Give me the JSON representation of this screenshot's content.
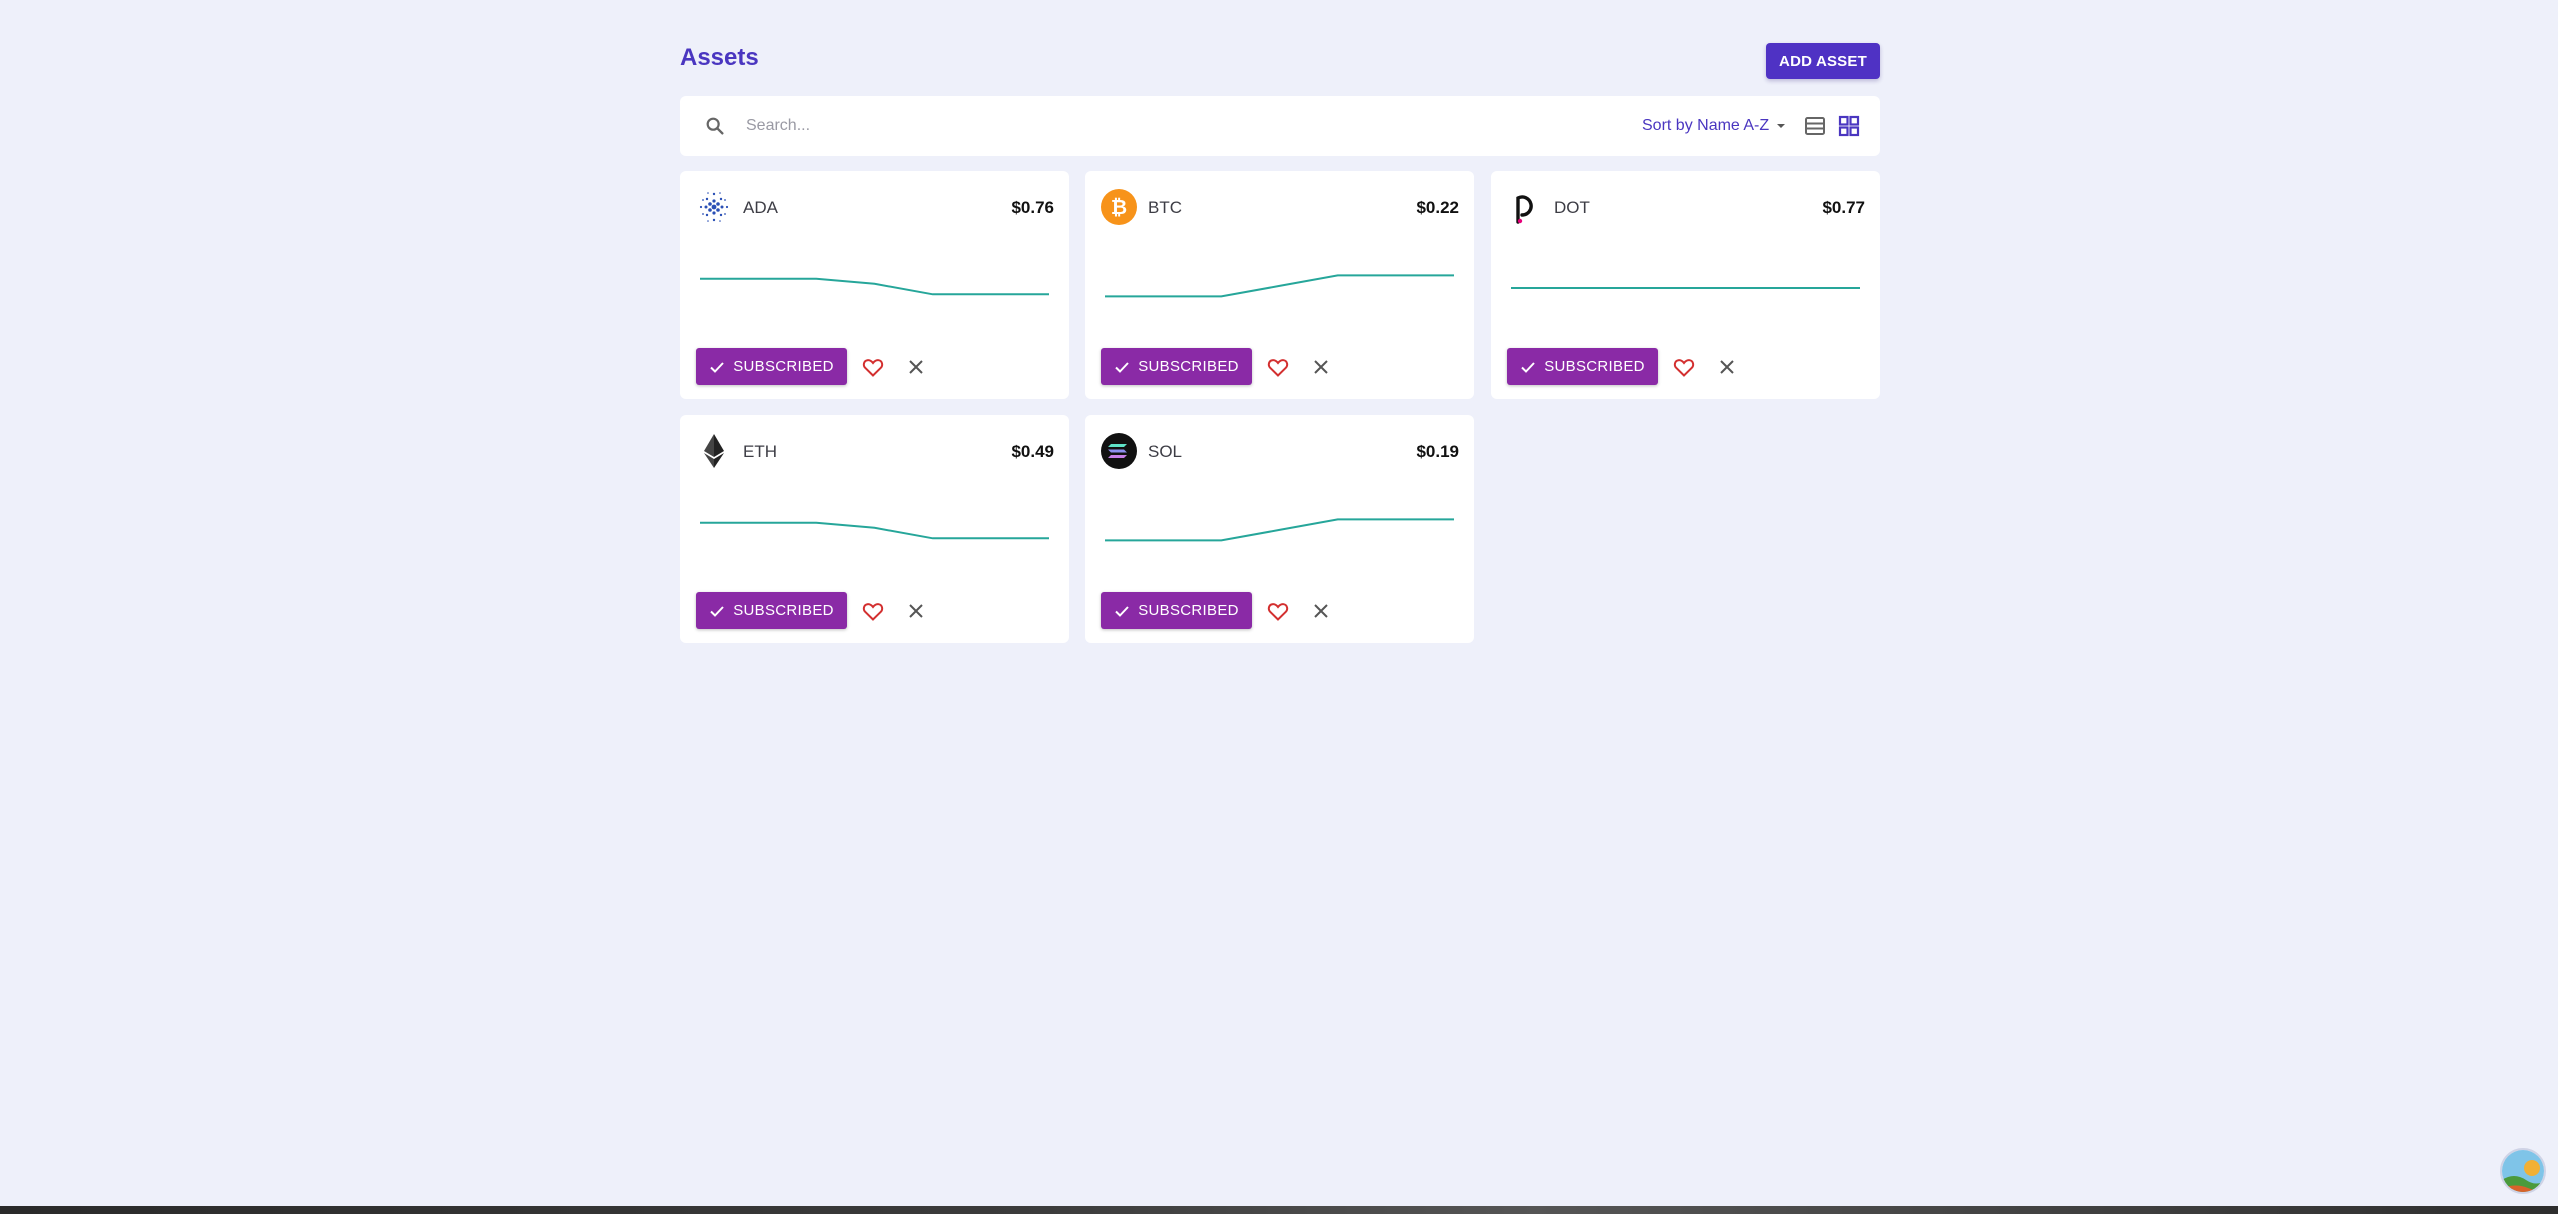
{
  "page": {
    "title": "Assets",
    "add_button": "ADD ASSET"
  },
  "toolbar": {
    "search_placeholder": "Search...",
    "sort_label": "Sort by Name A-Z",
    "views": [
      "list-view",
      "grid-view"
    ],
    "active_view": "grid-view"
  },
  "assets": [
    {
      "symbol": "ADA",
      "price": "$0.76",
      "icon": "cardano-logo-icon",
      "subscribe_label": "SUBSCRIBED",
      "trend": [
        0.72,
        0.72,
        0.72,
        0.6,
        0.35,
        0.35,
        0.35
      ]
    },
    {
      "symbol": "BTC",
      "price": "$0.22",
      "icon": "bitcoin-logo-icon",
      "subscribe_label": "SUBSCRIBED",
      "trend": [
        0.3,
        0.3,
        0.3,
        0.55,
        0.8,
        0.8,
        0.8
      ]
    },
    {
      "symbol": "DOT",
      "price": "$0.77",
      "icon": "polkadot-logo-icon",
      "subscribe_label": "SUBSCRIBED",
      "trend": [
        0.5,
        0.5,
        0.5,
        0.5,
        0.5,
        0.5,
        0.5
      ]
    },
    {
      "symbol": "ETH",
      "price": "$0.49",
      "icon": "ethereum-logo-icon",
      "subscribe_label": "SUBSCRIBED",
      "trend": [
        0.72,
        0.72,
        0.72,
        0.6,
        0.35,
        0.35,
        0.35
      ]
    },
    {
      "symbol": "SOL",
      "price": "$0.19",
      "icon": "solana-logo-icon",
      "subscribe_label": "SUBSCRIBED",
      "trend": [
        0.3,
        0.3,
        0.3,
        0.55,
        0.8,
        0.8,
        0.8
      ]
    }
  ],
  "colors": {
    "background": "#eef0fa",
    "accent": "#4f32c4",
    "subscribed": "#8a2aa6",
    "sparkline": "#26a69a",
    "favorite": "#d32f2f",
    "bitcoin": "#f7931a"
  }
}
